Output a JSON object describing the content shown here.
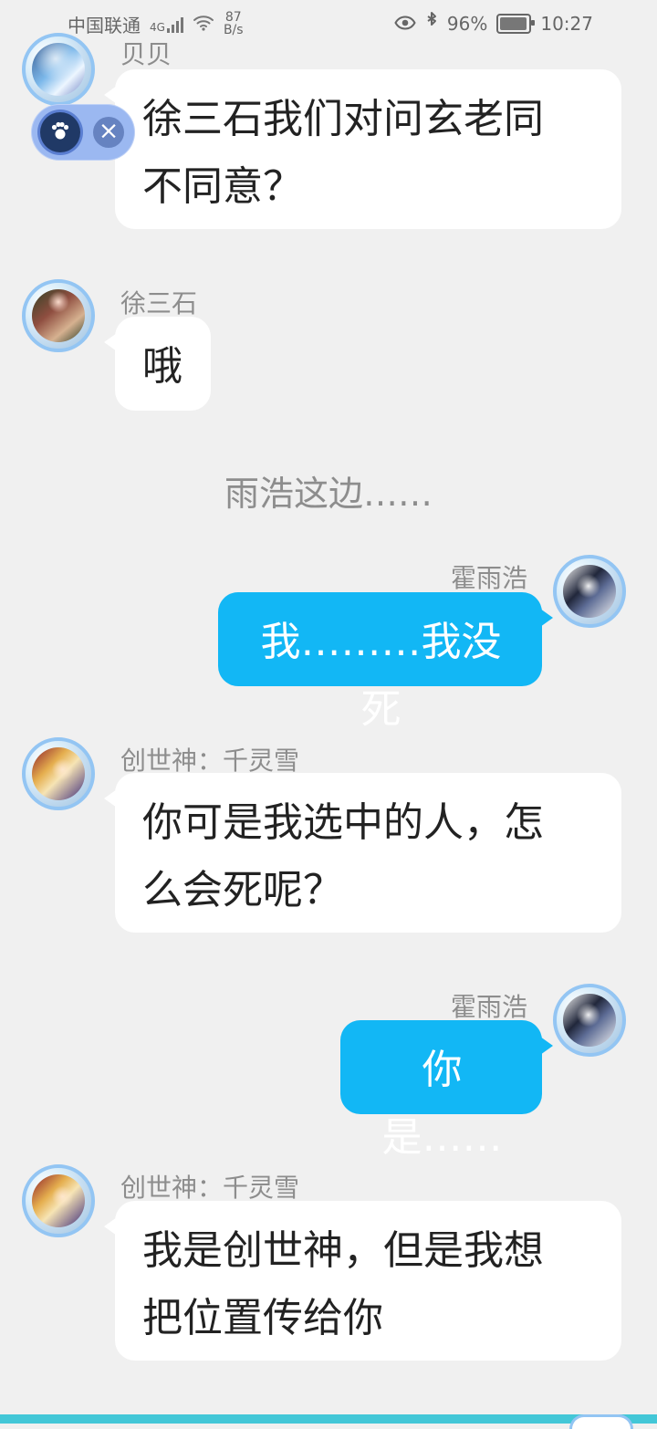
{
  "status_bar": {
    "carrier": "中国联通",
    "network": "4G",
    "speed_value": "87",
    "speed_unit": "B/s",
    "battery": "96%",
    "time": "10:27"
  },
  "messages": [
    {
      "type": "incoming",
      "sender": "贝贝",
      "text": "徐三石我们对问玄老同\n不同意？"
    },
    {
      "type": "incoming",
      "sender": "徐三石",
      "text": "哦"
    },
    {
      "type": "system",
      "text": "雨浩这边……"
    },
    {
      "type": "outgoing",
      "sender": "霍雨浩",
      "text": "我………我没死"
    },
    {
      "type": "incoming",
      "sender": "创世神：千灵雪",
      "text": "你可是我选中的人，怎\n么会死呢？"
    },
    {
      "type": "outgoing",
      "sender": "霍雨浩",
      "text": "你是……"
    },
    {
      "type": "incoming",
      "sender": "创世神：千灵雪",
      "text": "我是创世神，但是我想\n把位置传给你"
    }
  ],
  "floating_badge": {
    "icon": "paw-icon",
    "close": "×"
  },
  "colors": {
    "background": "#f0f0f0",
    "incoming_bubble": "#ffffff",
    "outgoing_bubble": "#12b7f5",
    "name_text": "#8d8d8d",
    "avatar_ring": "#93c5f3",
    "badge": "#9bb8f1"
  }
}
